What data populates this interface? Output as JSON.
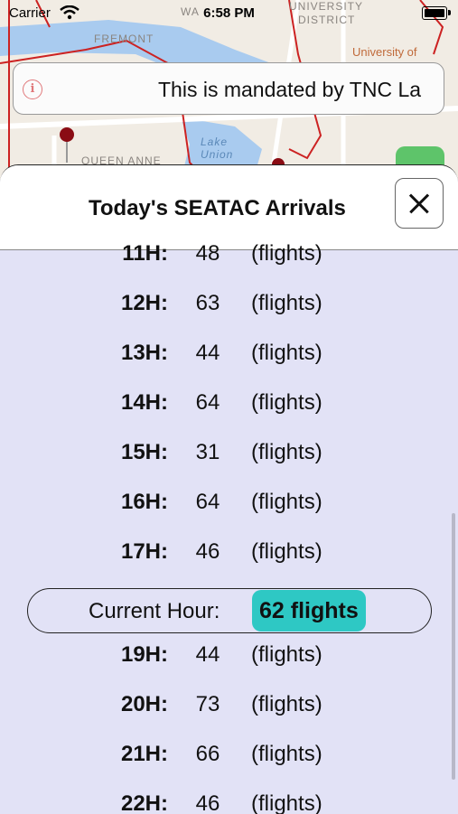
{
  "status_bar": {
    "carrier": "Carrier",
    "time": "6:58 PM"
  },
  "map": {
    "labels": [
      "FREMONT",
      "UNIVERSITY",
      "DISTRICT",
      "QUEEN ANNE",
      "Lake",
      "Union",
      "University of",
      "WA"
    ],
    "accent_color": "#cc2222"
  },
  "notice": {
    "text": "This is mandated by TNC La"
  },
  "sheet": {
    "title": "Today's SEATAC Arrivals",
    "rows_before": [
      {
        "hour": "11H:",
        "count": "48",
        "unit": "(flights)"
      },
      {
        "hour": "12H:",
        "count": "63",
        "unit": "(flights)"
      },
      {
        "hour": "13H:",
        "count": "44",
        "unit": "(flights)"
      },
      {
        "hour": "14H:",
        "count": "64",
        "unit": "(flights)"
      },
      {
        "hour": "15H:",
        "count": "31",
        "unit": "(flights)"
      },
      {
        "hour": "16H:",
        "count": "64",
        "unit": "(flights)"
      },
      {
        "hour": "17H:",
        "count": "46",
        "unit": "(flights)"
      }
    ],
    "current": {
      "label": "Current Hour:",
      "value": "62 flights"
    },
    "rows_after": [
      {
        "hour": "19H:",
        "count": "44",
        "unit": "(flights)"
      },
      {
        "hour": "20H:",
        "count": "73",
        "unit": "(flights)"
      },
      {
        "hour": "21H:",
        "count": "66",
        "unit": "(flights)"
      },
      {
        "hour": "22H:",
        "count": "46",
        "unit": "(flights)"
      }
    ],
    "colors": {
      "background": "#e2e2f6",
      "highlight": "#2ec8c4"
    }
  }
}
